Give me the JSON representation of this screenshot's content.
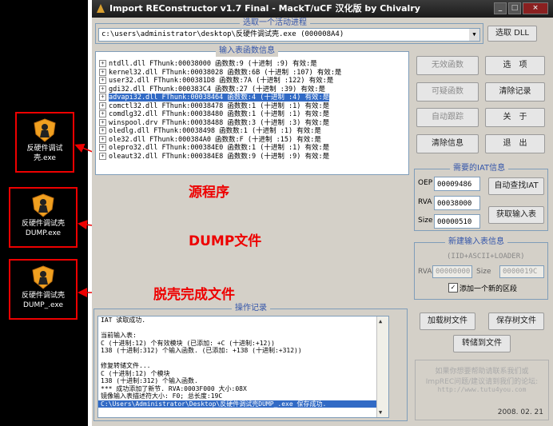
{
  "window": {
    "title": "Import REConstructor v1.7 Final - MackT/uCF 汉化版 by Chivalry",
    "controls": [
      "min",
      "max",
      "close"
    ]
  },
  "desktop_icons": [
    {
      "label": "反硬件调试壳.exe",
      "icon": "shield-icon"
    },
    {
      "label": "反硬件调试壳DUMP.exe",
      "icon": "shield-icon"
    },
    {
      "label": "反硬件调试壳DUMP_.exe",
      "icon": "shield-icon"
    }
  ],
  "annotations": {
    "source": "源程序",
    "dump": "DUMP文件",
    "unpacked": "脱壳完成文件"
  },
  "process_group": {
    "title": "选取一个活动进程",
    "selected": "c:\\users\\administrator\\desktop\\反硬件调试壳.exe (000008A4)",
    "pick_dll": "选取 DLL"
  },
  "imports_group": {
    "title": "输入表函数信息",
    "items": [
      "ntdll.dll FThunk:00038000 函数数:9 (十进制 :9) 有效:是",
      "kernel32.dll FThunk:00038028 函数数:6B (十进制 :107) 有效:是",
      "user32.dll FThunk:000381D8 函数数:7A (十进制 :122) 有效:是",
      "gdi32.dll FThunk:000383C4 函数数:27 (十进制 :39) 有效:是",
      "advapi32.dll FThunk:00038464 函数数:4 (十进制 :4) 有效:是",
      "comctl32.dll FThunk:00038478 函数数:1 (十进制 :1) 有效:是",
      "comdlg32.dll FThunk:00038480 函数数:1 (十进制 :1) 有效:是",
      "winspool.drv FThunk:00038488 函数数:3 (十进制 :3) 有效:是",
      "oledlg.dll FThunk:00038498 函数数:1 (十进制 :1) 有效:是",
      "ole32.dll FThunk:000384A0 函数数:F (十进制 :15) 有效:是",
      "olepro32.dll FThunk:000384E0 函数数:1 (十进制 :1) 有效:是",
      "oleaut32.dll FThunk:000384E8 函数数:9 (十进制 :9) 有效:是"
    ],
    "selected_index": 4
  },
  "right_buttons": {
    "invalid": "无效函数",
    "options": "选　项",
    "suspect": "可疑函数",
    "clear_log": "清除记录",
    "auto_trace": "自动跟踪",
    "about": "关　于",
    "clear_info": "清除信息",
    "exit": "退　出"
  },
  "iat_group": {
    "title": "需要的IAT信息",
    "oep_label": "OEP",
    "oep_value": "00009486",
    "rva_label": "RVA",
    "rva_value": "00038000",
    "size_label": "Size",
    "size_value": "00000510",
    "auto_iat": "自动查找IAT",
    "get_imports": "获取输入表"
  },
  "new_import_group": {
    "title": "新建输入表信息",
    "subtitle": "(IID+ASCII+LOADER)",
    "rva_label": "RVA",
    "rva_value": "00000000",
    "size_label": "Size",
    "size_value": "0000019C",
    "add_section_label": "添加一个新的区段",
    "add_section_checked": true
  },
  "log_group": {
    "title": "操作记录",
    "lines": [
      "IAT 读取成功.",
      "",
      "当前输入表:",
      "C (十进制:12) 个有效模块 (已添加: +C (十进制:+12))",
      "138 (十进制:312) 个输入函数. (已添加: +138 (十进制:+312))",
      "",
      "修复转储文件...",
      "C (十进制:12) 个模块",
      "138 (十进制:312) 个输入函数.",
      "*** 成功添加了新节. RVA:0003F000 大小:08X",
      "镜像输入表描述符大小: F0; 总长度:19C",
      "C:\\Users\\Administrator\\Desktop\\反硬件调试壳DUMP_.exe 保存成功."
    ],
    "highlight_index": 11
  },
  "tree_buttons": {
    "load_tree": "加载树文件",
    "save_tree": "保存树文件",
    "convert_file": "转储到文件"
  },
  "footer": {
    "notice_line1": "如果你想要帮助请联系我们或",
    "notice_line2": "ImpREC问题/建议请到我们的论坛:",
    "url": "http://www.tutu4you.com",
    "date": "2008. 02. 21"
  }
}
